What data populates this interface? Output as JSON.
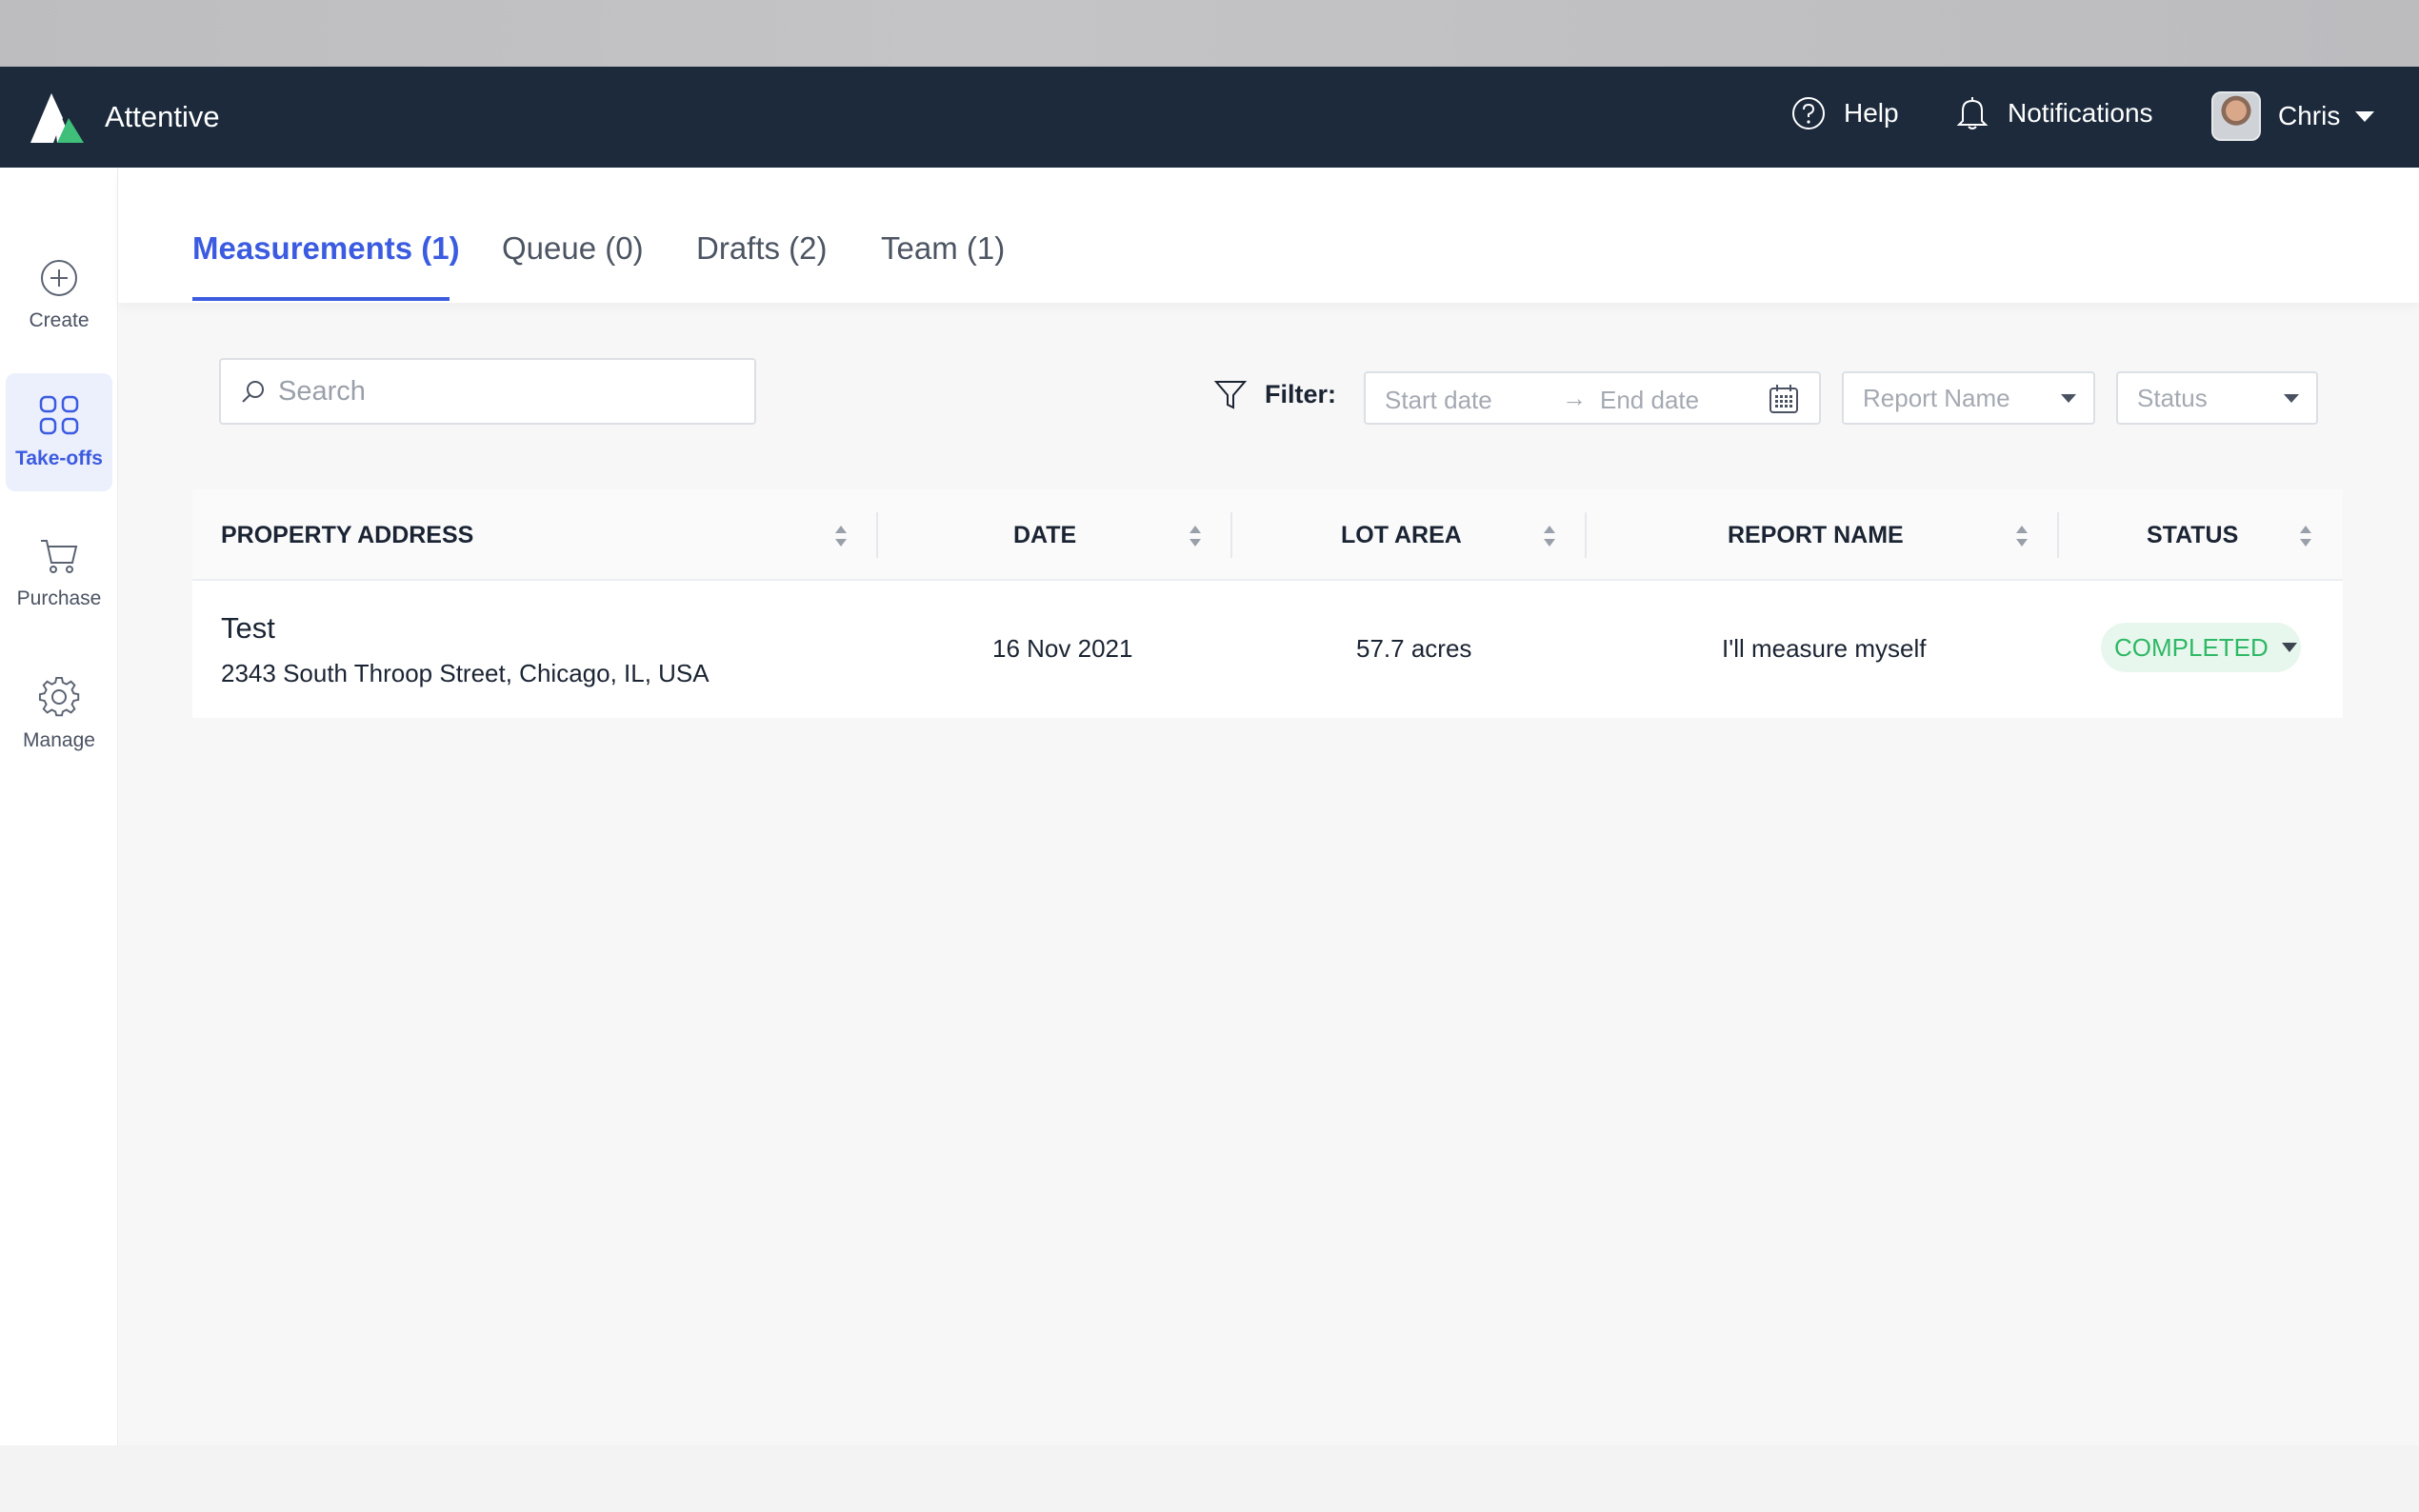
{
  "app": {
    "brand": "Attentive"
  },
  "header": {
    "help_label": "Help",
    "notifications_label": "Notifications",
    "user_name": "Chris"
  },
  "sidebar": {
    "items": [
      {
        "label": "Create",
        "icon": "plus-circle-icon",
        "active": false
      },
      {
        "label": "Take-offs",
        "icon": "grid-icon",
        "active": true
      },
      {
        "label": "Purchase",
        "icon": "cart-icon",
        "active": false
      },
      {
        "label": "Manage",
        "icon": "gear-icon",
        "active": false
      }
    ]
  },
  "tabs": [
    {
      "label": "Measurements (1)",
      "active": true
    },
    {
      "label": "Queue (0)",
      "active": false
    },
    {
      "label": "Drafts (2)",
      "active": false
    },
    {
      "label": "Team (1)",
      "active": false
    }
  ],
  "search": {
    "placeholder": "Search",
    "value": ""
  },
  "filter": {
    "label": "Filter:",
    "start_placeholder": "Start date",
    "end_placeholder": "End date",
    "report_name_placeholder": "Report Name",
    "status_placeholder": "Status"
  },
  "table": {
    "columns": [
      "PROPERTY ADDRESS",
      "DATE",
      "LOT AREA",
      "REPORT NAME",
      "STATUS"
    ],
    "rows": [
      {
        "title": "Test",
        "address": "2343 South Throop Street, Chicago, IL, USA",
        "date": "16 Nov 2021",
        "lot_area": "57.7 acres",
        "report_name": "I'll measure myself",
        "status": "COMPLETED"
      }
    ]
  },
  "colors": {
    "topbar": "#1c2a3c",
    "accent": "#3b5be0",
    "status_completed": "#2fb865"
  }
}
